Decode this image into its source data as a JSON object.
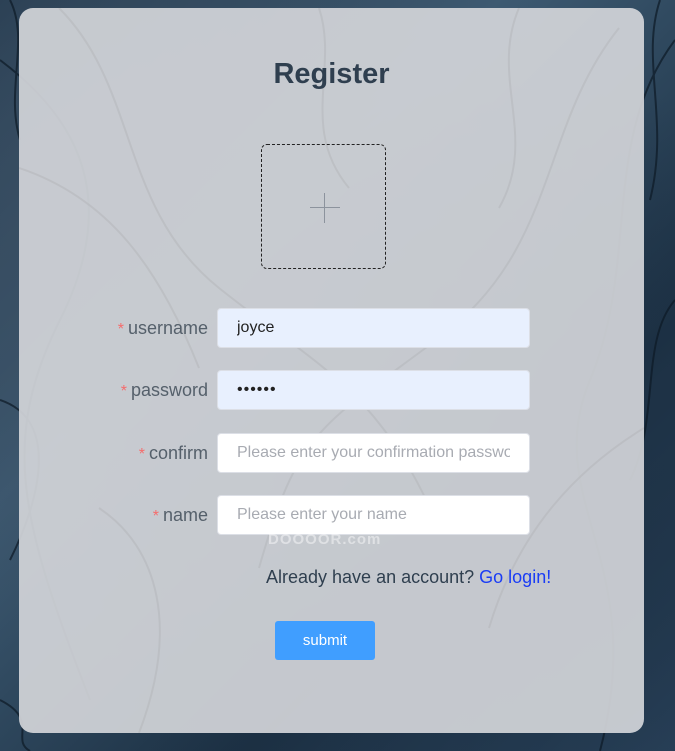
{
  "page": {
    "title": "Register"
  },
  "form": {
    "fields": [
      {
        "label": "username",
        "value": "joyce",
        "placeholder": ""
      },
      {
        "label": "password",
        "value": "abcdef",
        "placeholder": ""
      },
      {
        "label": "confirm",
        "value": "",
        "placeholder": "Please enter your confirmation password"
      },
      {
        "label": "name",
        "value": "",
        "placeholder": "Please enter your name"
      }
    ],
    "required_marker": "*"
  },
  "watermark": "DOOOOR.com",
  "login_prompt": {
    "text": "Already have an account?",
    "link": "Go login!"
  },
  "submit_label": "submit",
  "colors": {
    "accent": "#409eff",
    "link": "#1a3cf5",
    "required": "#f56c6c",
    "autofill": "#e8f0fe"
  },
  "icons": {
    "upload": "plus-icon"
  }
}
